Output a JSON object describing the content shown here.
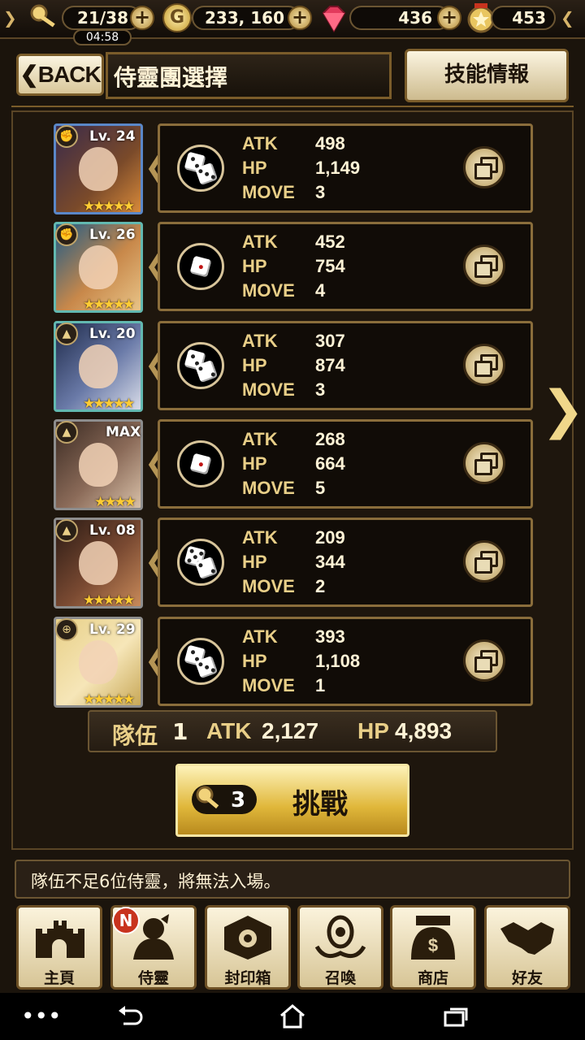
{
  "status": {
    "keys": "21/38",
    "timer": "04:58",
    "gold": "233, 160",
    "gems": "436",
    "medals": "453"
  },
  "header": {
    "back_label": "BACK",
    "title": "侍靈團選擇",
    "skill_info_label": "技能情報"
  },
  "units": [
    {
      "level": "Lv. 24",
      "stars": "★★★★★",
      "atk": "498",
      "hp": "1,149",
      "move": "3"
    },
    {
      "level": "Lv. 26",
      "stars": "★★★★★",
      "atk": "452",
      "hp": "754",
      "move": "4"
    },
    {
      "level": "Lv. 20",
      "stars": "★★★★★",
      "atk": "307",
      "hp": "874",
      "move": "3"
    },
    {
      "level": "MAX",
      "stars": "★★★★",
      "atk": "268",
      "hp": "664",
      "move": "5"
    },
    {
      "level": "Lv. 08",
      "stars": "★★★★★",
      "atk": "209",
      "hp": "344",
      "move": "2"
    },
    {
      "level": "Lv. 29",
      "stars": "★★★★★",
      "atk": "393",
      "hp": "1,108",
      "move": "1"
    }
  ],
  "stat_labels": {
    "atk": "ATK",
    "hp": "HP",
    "move": "MOVE"
  },
  "team": {
    "label": "隊伍",
    "number": "1",
    "atk_label": "ATK",
    "atk_value": "2,127",
    "hp_label": "HP",
    "hp_value": "4,893"
  },
  "challenge": {
    "key_cost": "3",
    "label": "挑戰"
  },
  "notice": "隊伍不足6位侍靈，將無法入場。",
  "nav": {
    "home": "主頁",
    "spirits": "侍靈",
    "seal_box": "封印箱",
    "summon": "召喚",
    "shop": "商店",
    "friends": "好友",
    "new_badge": "N"
  },
  "icons": [
    "key-icon",
    "gold-coin-icon",
    "gem-icon",
    "medal-icon",
    "plus-icon",
    "dice-icon",
    "detail-icon",
    "chevron-right-icon",
    "castle-icon",
    "spirit-icon",
    "seal-box-icon",
    "summon-icon",
    "shop-icon",
    "handshake-icon"
  ]
}
